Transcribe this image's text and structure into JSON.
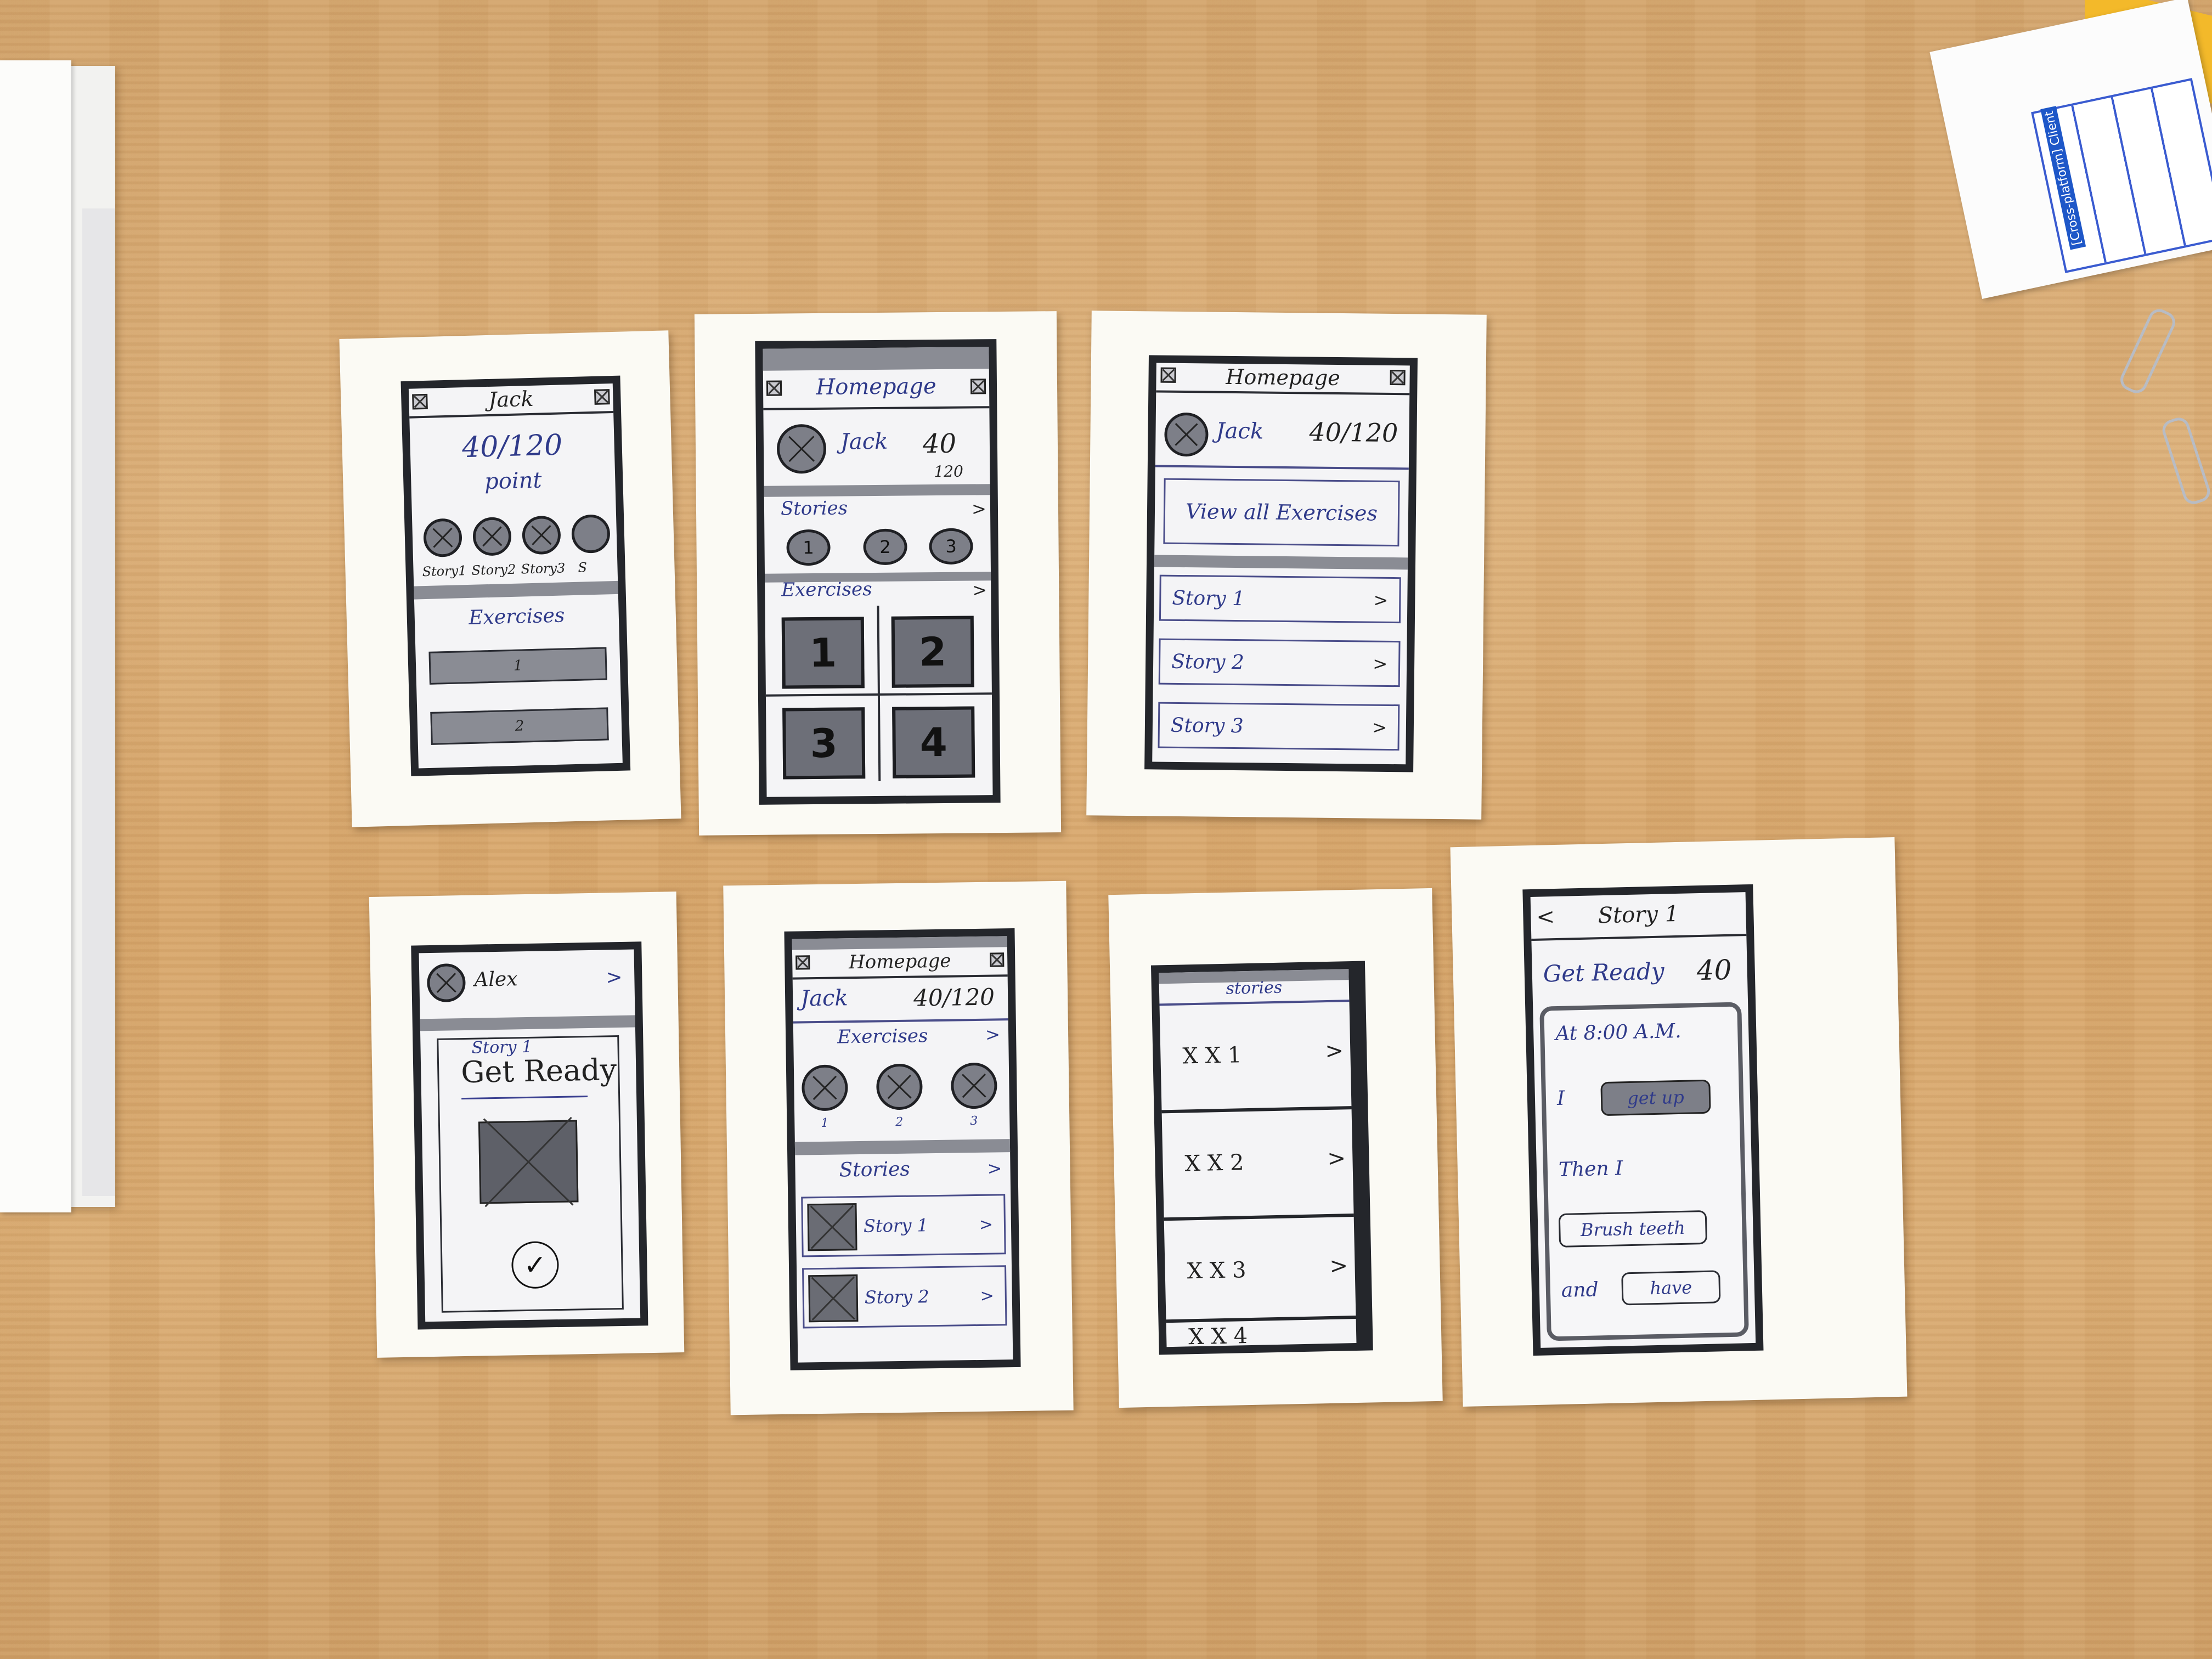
{
  "s1": {
    "title": "Jack",
    "score": "40/120",
    "unit": "point",
    "stories": [
      "Story1",
      "Story2",
      "Story3",
      "S"
    ],
    "section": "Exercises",
    "items": [
      "1",
      "2"
    ]
  },
  "s2": {
    "title": "Homepage",
    "user": "Jack",
    "score_top": "40",
    "score_bottom": "120",
    "stories_label": "Stories",
    "story_nums": [
      "1",
      "2",
      "3"
    ],
    "exercises_label": "Exercises",
    "ex_nums": [
      "1",
      "2",
      "3",
      "4"
    ],
    "arrow": ">"
  },
  "s3": {
    "title": "Homepage",
    "user": "Jack",
    "score": "40/120",
    "view_all": "View all Exercises",
    "rows": [
      "Story 1",
      "Story 2",
      "Story 3"
    ],
    "arrow": ">"
  },
  "s4": {
    "user": "Alex",
    "arrow": ">",
    "story_label": "Story 1",
    "heading": "Get Ready",
    "check": "✓"
  },
  "s5": {
    "title": "Homepage",
    "user": "Jack",
    "score": "40/120",
    "exercises_label": "Exercises",
    "ex_nums": [
      "1",
      "2",
      "3"
    ],
    "stories_label": "Stories",
    "rows": [
      "Story 1",
      "Story 2"
    ],
    "arrow": ">"
  },
  "s6": {
    "title": "stories",
    "rows": [
      "X X 1",
      "X X 2",
      "X X 3",
      "X X 4"
    ],
    "arrow": ">"
  },
  "s7": {
    "back": "<",
    "title": "Story 1",
    "heading": "Get Ready",
    "points": "40",
    "line1": "At 8:00 A.M.",
    "i_word": "I",
    "chip1": "get up",
    "then": "Then  I",
    "chip2": "Brush teeth",
    "and_word": "and",
    "chip3": "have"
  },
  "corner_note": {
    "label": "[Cross-platform] Client"
  }
}
